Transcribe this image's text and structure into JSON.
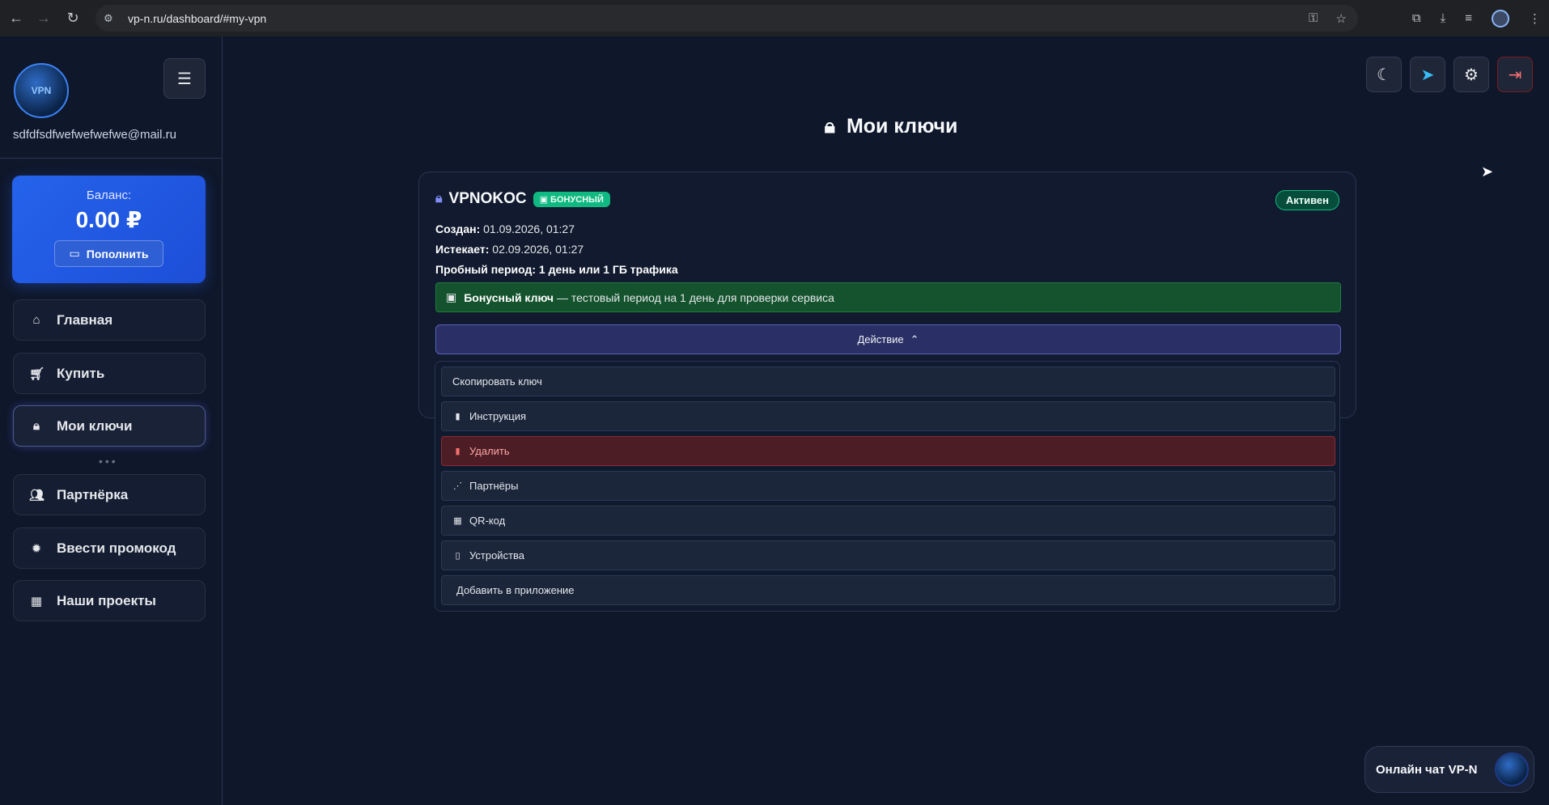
{
  "browser": {
    "url": "vp-n.ru/dashboard/#my-vpn"
  },
  "sidebar": {
    "logo_text": "VPN",
    "email": "sdfdfsdfwefwefwefwe@mail.ru",
    "balance": {
      "label": "Баланс:",
      "value": "0.00 ₽",
      "topup_label": "Пополнить"
    },
    "items": [
      {
        "label": "Главная",
        "icon": "home-icon"
      },
      {
        "label": "Купить",
        "icon": "cart-icon"
      },
      {
        "label": "Мои ключи",
        "icon": "lock-icon",
        "active": true
      },
      {
        "label": "Партнёрка",
        "icon": "users-icon"
      },
      {
        "label": "Ввести промокод",
        "icon": "badge-icon"
      },
      {
        "label": "Наши проекты",
        "icon": "grid-icon"
      }
    ]
  },
  "header": {
    "title": "Мои ключи"
  },
  "key_card": {
    "name": "VPNOKOC",
    "bonus_badge": "бонусный",
    "status": "Активен",
    "created_label": "Создан:",
    "created_value": "01.09.2026, 01:27",
    "expires_label": "Истекает:",
    "expires_value": "02.09.2026, 01:27",
    "trial_text": "Пробный период: 1 день или 1 ГБ трафика",
    "bonus_note_bold": "Бонусный ключ",
    "bonus_note_rest": "— тестовый период на 1 день для проверки сервиса",
    "action_label": "Действие"
  },
  "actions_menu": [
    {
      "label": "Скопировать ключ",
      "icon": ""
    },
    {
      "label": "Инструкция",
      "icon": "book-icon"
    },
    {
      "label": "Удалить",
      "icon": "trash-icon",
      "danger": true
    },
    {
      "label": "Партнёры",
      "icon": "partners-icon"
    },
    {
      "label": "QR-код",
      "icon": "qr-icon"
    },
    {
      "label": "Устройства",
      "icon": "device-icon"
    },
    {
      "label": "Добавить в приложение",
      "icon": ""
    }
  ],
  "chat": {
    "label": "Онлайн чат VP-N"
  },
  "colors": {
    "background": "#0f172b",
    "accent": "#2563eb",
    "success": "#10b981",
    "danger": "#8c2a35"
  }
}
